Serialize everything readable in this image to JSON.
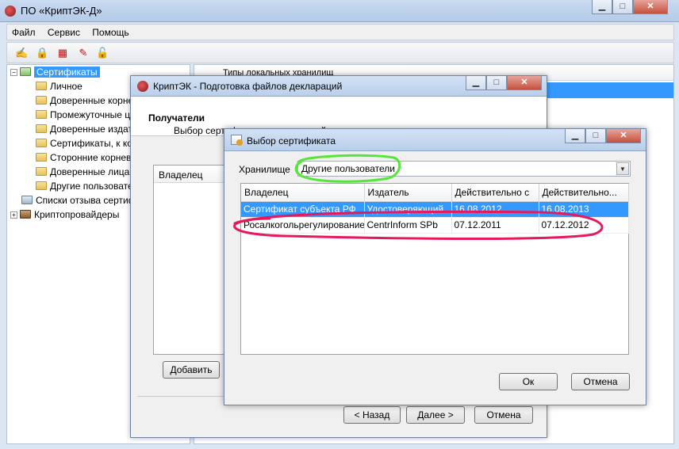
{
  "app": {
    "title": "ПО «КриптЭК-Д»"
  },
  "window_buttons": {
    "minimize": "▁",
    "maximize": "□",
    "close": "✕"
  },
  "menu": [
    "Файл",
    "Сервис",
    "Помощь"
  ],
  "toolbar_icons": [
    "sign-icon",
    "lock-icon",
    "encrypt-icon",
    "decrypt-icon",
    "unlock-icon"
  ],
  "tree": {
    "root": "Сертификаты",
    "children": [
      "Личное",
      "Доверенные корневые",
      "Промежуточные цен",
      "Доверенные издате",
      "Сертификаты, к кот",
      "Сторонние корневы",
      "Доверенные лица",
      "Другие пользовате"
    ],
    "revocation": "Списки отзыва сертиф",
    "providers": "Криптопровайдеры"
  },
  "right_pane": {
    "header": "Типы локальных хранилищ"
  },
  "dialog1": {
    "title": "КриптЭК - Подготовка файлов деклараций",
    "heading": "Получатели",
    "subheading": "Выбор сертификатов получателей",
    "column_owner": "Владелец",
    "add_button": "Добавить",
    "back_button": "< Назад",
    "next_button": "Далее >",
    "cancel_button": "Отмена"
  },
  "dialog2": {
    "title": "Выбор сертификата",
    "store_label": "Хранилище",
    "store_value": "Другие пользователи",
    "columns": [
      "Владелец",
      "Издатель",
      "Действительно с",
      "Действительно..."
    ],
    "rows": [
      [
        "Сертификат субъекта РФ",
        "Удостоверяющий...",
        "16.08.2012",
        "16.08.2013"
      ],
      [
        "Росалкогольрегулирование",
        "CentrInform SPb",
        "07.12.2011",
        "07.12.2012"
      ]
    ],
    "ok_button": "Ок",
    "cancel_button": "Отмена"
  },
  "colors": {
    "selection": "#3399ff",
    "annotation_green": "#55e63a",
    "annotation_red": "#e8195a"
  }
}
